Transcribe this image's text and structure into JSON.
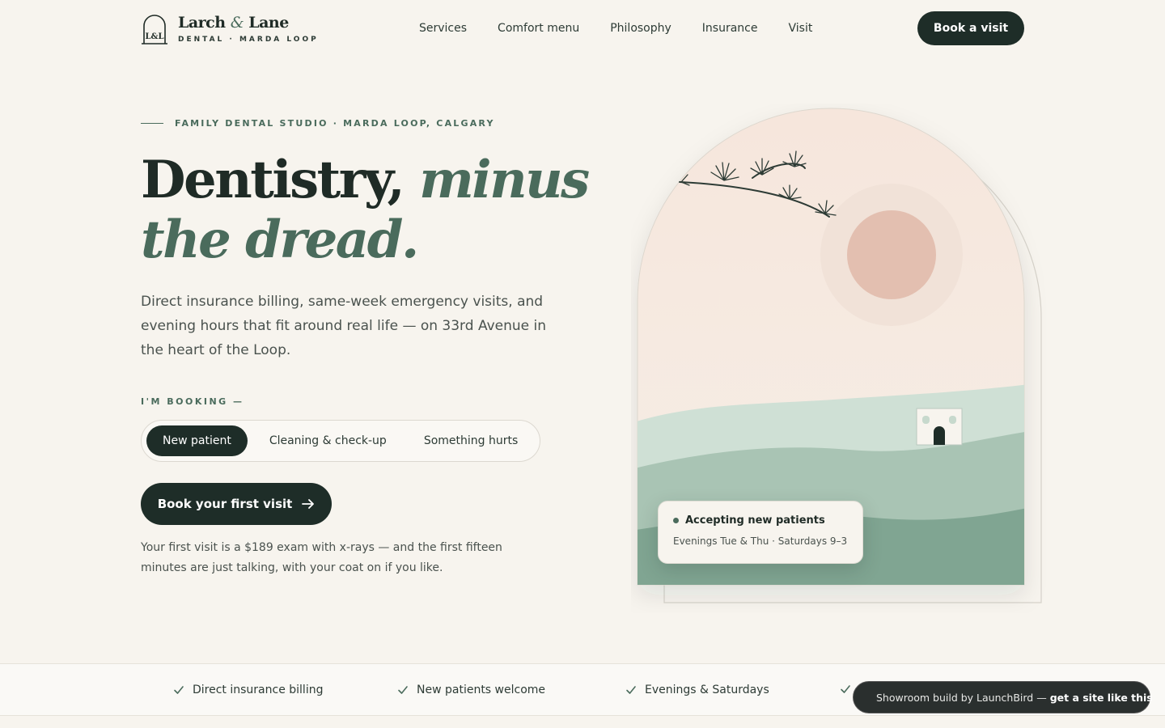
{
  "brand": {
    "name_part1": "Larch",
    "ampersand": "&",
    "name_part2": "Lane",
    "subtitle": "DENTAL · MARDA LOOP",
    "monogram": "L&L"
  },
  "nav": {
    "items": [
      {
        "label": "Services"
      },
      {
        "label": "Comfort menu"
      },
      {
        "label": "Philosophy"
      },
      {
        "label": "Insurance"
      },
      {
        "label": "Visit"
      }
    ],
    "cta_label": "Book a visit"
  },
  "hero": {
    "eyebrow": "FAMILY DENTAL STUDIO · MARDA LOOP, CALGARY",
    "headline_plain": "Dentistry,",
    "headline_em_line1": "minus",
    "headline_em_line2": "the dread.",
    "lede": "Direct insurance billing, same-week emergency visits, and evening hours that fit around real life — on 33rd Avenue in the heart of the Loop.",
    "booking_label": "I'M BOOKING —",
    "booking_options": [
      {
        "label": "New patient",
        "selected": true
      },
      {
        "label": "Cleaning & check-up",
        "selected": false
      },
      {
        "label": "Something hurts",
        "selected": false
      }
    ],
    "cta_label": "Book your first visit",
    "fine_print": "Your first visit is a $189 exam with x-rays — and the first fifteen minutes are just talking, with your coat on if you like."
  },
  "status_card": {
    "title": "Accepting new patients",
    "hours": "Evenings Tue & Thu · Saturdays 9–3"
  },
  "trust_strip": {
    "items": [
      {
        "label": "Direct insurance billing"
      },
      {
        "label": "New patients welcome"
      },
      {
        "label": "Evenings & Saturdays"
      }
    ]
  },
  "toast": {
    "text": "Showroom build by LaunchBird —",
    "link": "get a site like this"
  },
  "colors": {
    "background": "#f7f4ee",
    "primary_dark": "#1e2d28",
    "accent_green": "#4a6b5c",
    "sun": "#e3bfb0",
    "hill_light": "#cfe0d5",
    "hill_mid": "#a9c4b4",
    "hill_dark": "#80a592"
  },
  "icons": {
    "logo": "arch-monogram-icon",
    "cta_arrow": "arrow-right-icon",
    "check": "check-icon",
    "toast": "bird-icon"
  }
}
